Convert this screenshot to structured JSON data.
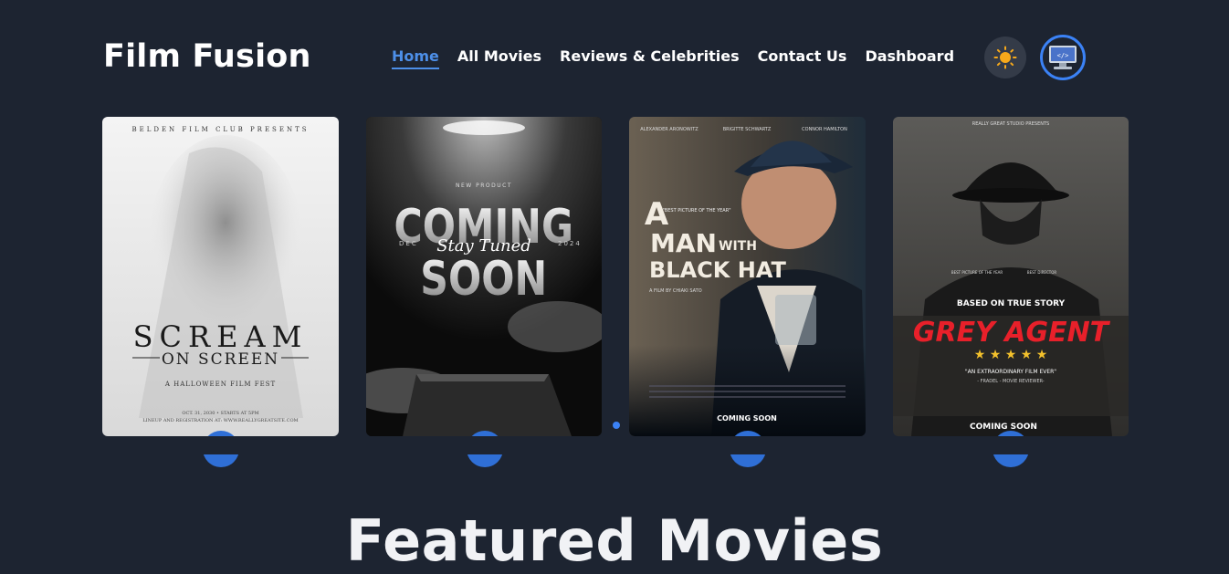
{
  "brand": {
    "name": "Film Fusion"
  },
  "nav": {
    "items": [
      {
        "label": "Home",
        "active": true
      },
      {
        "label": "All Movies"
      },
      {
        "label": "Reviews & Celebrities"
      },
      {
        "label": "Contact Us"
      },
      {
        "label": "Dashboard"
      }
    ]
  },
  "icons": {
    "theme": "sun-icon",
    "avatar": "computer-icon"
  },
  "colors": {
    "background": "#1d2431",
    "accent": "#4d8fe8",
    "sun": "#f7a91b"
  },
  "posters": [
    {
      "kicker": "BELDEN FILM CLUB PRESENTS",
      "title_line1": "SCREAM",
      "title_line2": "ON SCREEN",
      "subtitle": "A HALLOWEEN FILM FEST",
      "footer1": "OCT. 31, 2030 • STARTS AT 5PM",
      "footer2": "LINEUP AND REGISTRATION AT: WWW.REALLYGREATSITE.COM"
    },
    {
      "kicker": "NEW PRODUCT",
      "title_line1": "COMING",
      "title_line2": "SOON",
      "script": "Stay Tuned",
      "left_date": "DEC",
      "right_date": "2024"
    },
    {
      "names": [
        "ALEXANDER ARONOWITZ",
        "BRIGITTE SCHWARTZ",
        "CONNOR HAMILTON"
      ],
      "award": "\"BEST PICTURE OF THE YEAR\"",
      "title_line1": "A",
      "title_line2": "MAN",
      "title_with": "WITH",
      "title_line3": "BLACK HAT",
      "credit": "A FILM BY CHIAKI SATO",
      "footer": "COMING SOON"
    },
    {
      "kicker": "REALLY GREAT STUDIO PRESENTS",
      "award1": "BEST PICTURE OF THE YEAR",
      "award2": "BEST DIRECTOR",
      "tagline": "BASED ON TRUE STORY",
      "title": "GREY AGENT",
      "stars": "★ ★ ★ ★ ★",
      "quote": "\"AN EXTRAORDINARY FILM EVER\"",
      "reviewer": "- FRADEL - MOVIE REVIEWER-",
      "footer": "COMING SOON"
    }
  ],
  "section": {
    "featured_title": "Featured Movies"
  }
}
